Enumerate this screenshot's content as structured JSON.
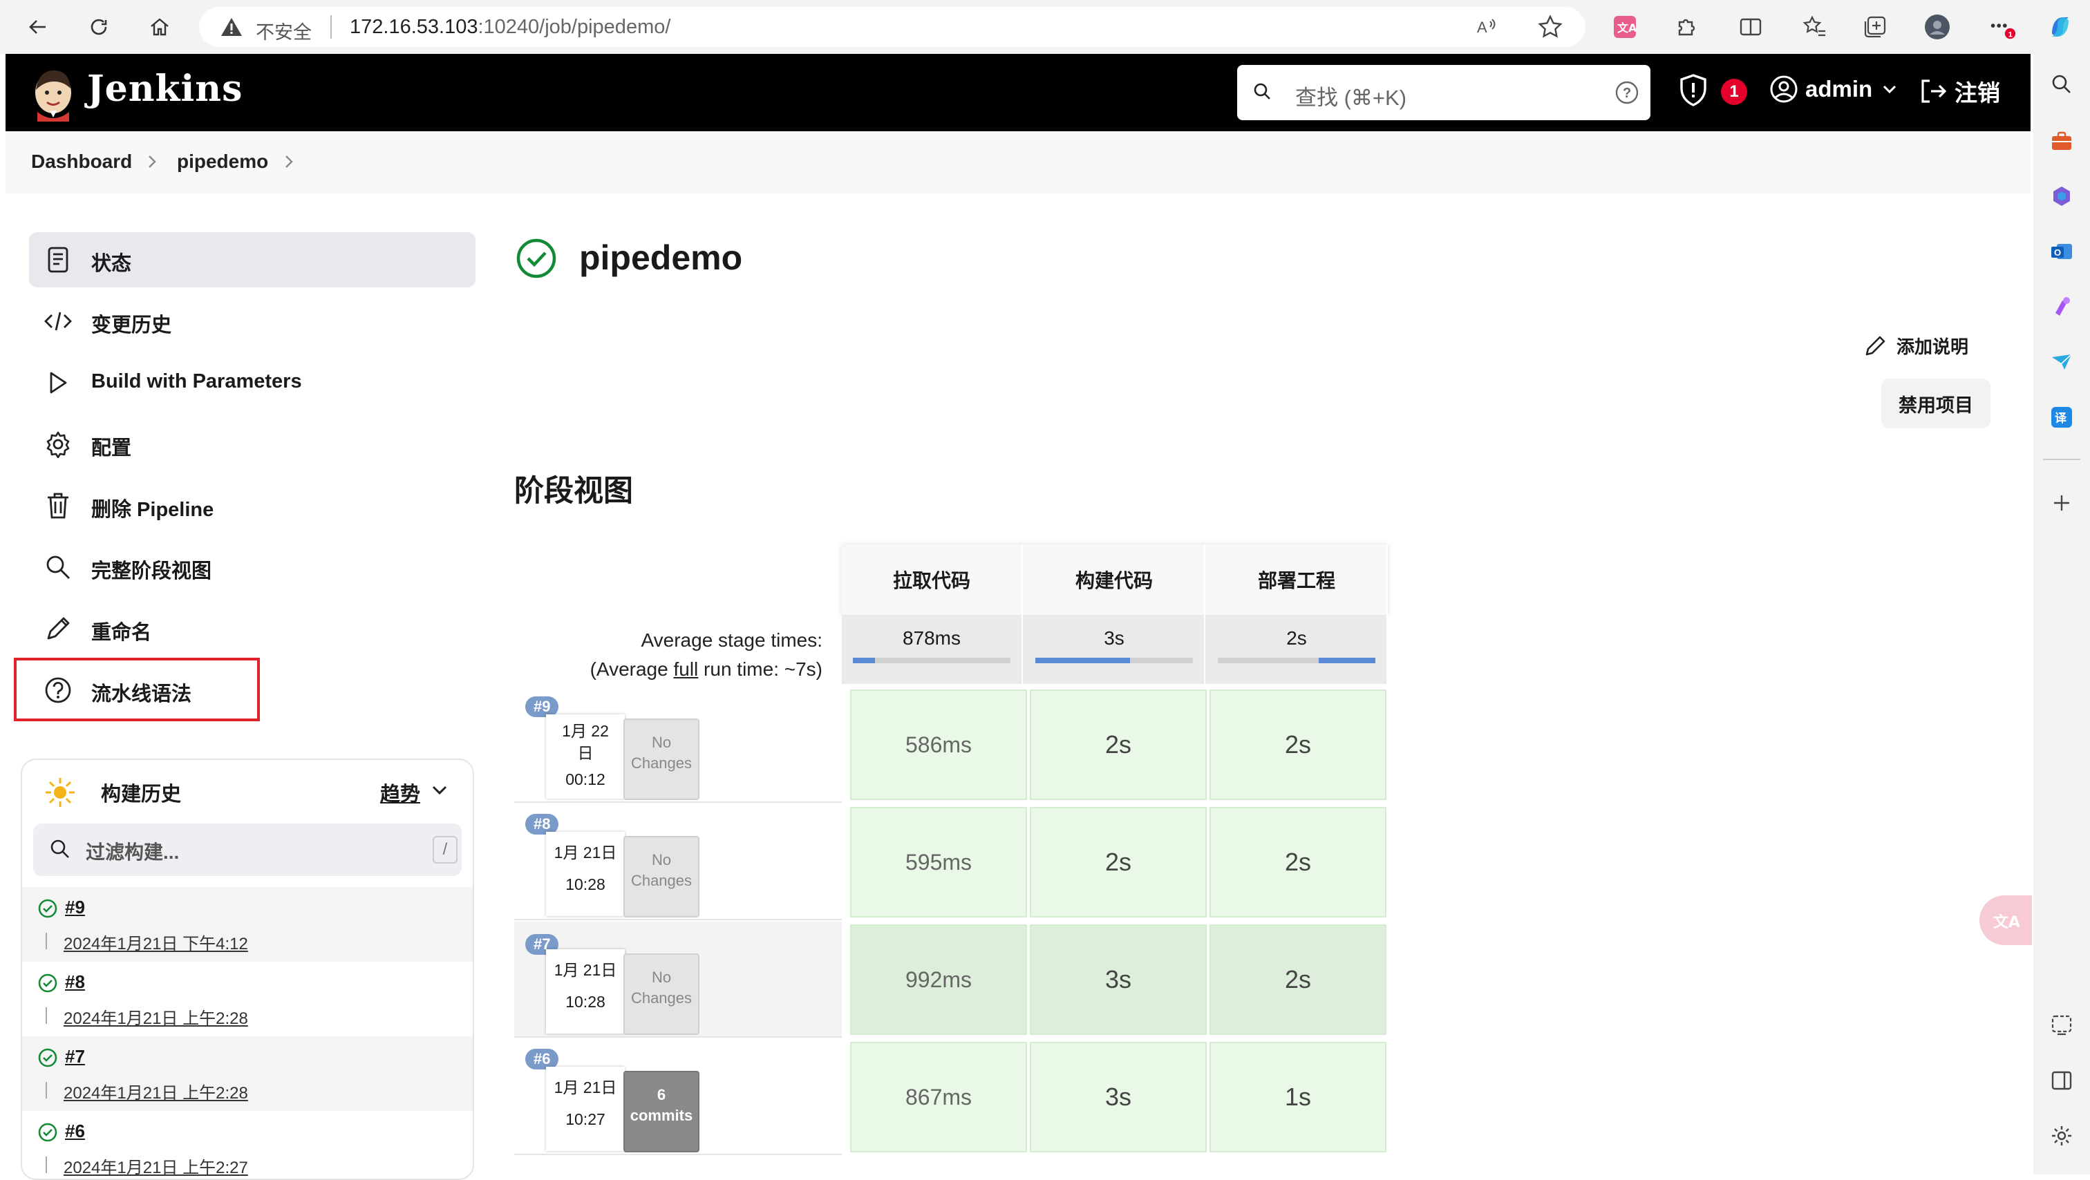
{
  "browser": {
    "insecure_label": "不安全",
    "url_host": "172.16.53.103",
    "url_rest": ":10240/job/pipedemo/"
  },
  "header": {
    "app_name": "Jenkins",
    "search_placeholder": "查找 (⌘+K)",
    "security_count": "1",
    "user": "admin",
    "logout": "注销"
  },
  "breadcrumb": [
    "Dashboard",
    "pipedemo"
  ],
  "sidebar": {
    "items": [
      {
        "label": "状态",
        "icon": "status-doc-icon"
      },
      {
        "label": "变更历史",
        "icon": "code-icon"
      },
      {
        "label": "Build with Parameters",
        "icon": "play-icon"
      },
      {
        "label": "配置",
        "icon": "gear-icon"
      },
      {
        "label": "删除 Pipeline",
        "icon": "trash-icon"
      },
      {
        "label": "完整阶段视图",
        "icon": "search-icon"
      },
      {
        "label": "重命名",
        "icon": "pencil-icon"
      },
      {
        "label": "流水线语法",
        "icon": "help-icon"
      }
    ]
  },
  "build_history": {
    "title": "构建历史",
    "trend": "趋势",
    "filter_placeholder": "过滤构建...",
    "filter_shortcut": "/",
    "builds": [
      {
        "num": "#9",
        "date": "2024年1月21日 下午4:12"
      },
      {
        "num": "#8",
        "date": "2024年1月21日 上午2:28"
      },
      {
        "num": "#7",
        "date": "2024年1月21日 上午2:28"
      },
      {
        "num": "#6",
        "date": "2024年1月21日 上午2:27"
      }
    ]
  },
  "main": {
    "title": "pipedemo",
    "add_description": "添加说明",
    "disable_project": "禁用项目",
    "stage_view_title": "阶段视图"
  },
  "stage_view": {
    "stages": [
      "拉取代码",
      "构建代码",
      "部署工程"
    ],
    "avg_label_line1": "Average stage times:",
    "avg_label_line2_pre": "(Average ",
    "avg_label_line2_link": "full",
    "avg_label_line2_post": " run time: ~7s)",
    "avg_times": [
      "878ms",
      "3s",
      "2s"
    ],
    "runs": [
      {
        "badge": "#9",
        "date_line1": "1月 22",
        "date_line2": "日",
        "time": "00:12",
        "changes": "No Changes",
        "times": [
          "586ms",
          "2s",
          "2s"
        ]
      },
      {
        "badge": "#8",
        "date_line1": "1月 21日",
        "date_line2": "",
        "time": "10:28",
        "changes": "No Changes",
        "times": [
          "595ms",
          "2s",
          "2s"
        ]
      },
      {
        "badge": "#7",
        "date_line1": "1月 21日",
        "date_line2": "",
        "time": "10:28",
        "changes": "No Changes",
        "times": [
          "992ms",
          "3s",
          "2s"
        ]
      },
      {
        "badge": "#6",
        "date_line1": "1月 21日",
        "date_line2": "",
        "time": "10:27",
        "changes_num": "6",
        "changes_word": "commits",
        "times": [
          "867ms",
          "3s",
          "1s"
        ]
      }
    ]
  },
  "colors": {
    "header_bg": "#000000",
    "success_green": "#138a36",
    "stage_cell_bg": "#e9f8e7",
    "highlight_red": "#e0242c",
    "badge_blue": "#7a9ac9"
  }
}
